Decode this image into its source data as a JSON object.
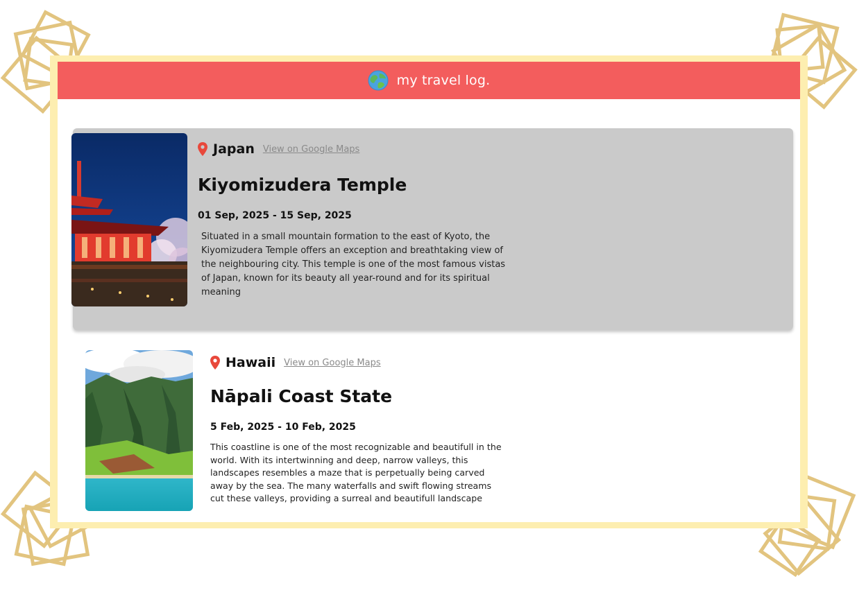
{
  "header": {
    "logo_icon": "globe-icon",
    "title": "my travel log."
  },
  "colors": {
    "header_bg": "#f35d5d",
    "frame": "#fdeeb0",
    "decoration": "#e2c47f",
    "selected_card": "#cacaca",
    "pin": "#e8483b"
  },
  "entries": [
    {
      "pin_icon": "location-pin-icon",
      "country": "Japan",
      "maps_link": "View on Google Maps",
      "place": "Kiyomizudera Temple",
      "dates": "01 Sep, 2025 - 15 Sep, 2025",
      "description": "Situated in a small mountain formation to the east of Kyoto, the Kiyomizudera Temple offers an exception and breathtaking view of the neighbouring city. This temple is one of the most famous vistas of Japan, known for its beauty all year-round and for its spiritual meaning",
      "photo_icon": "temple-photo"
    },
    {
      "pin_icon": "location-pin-icon",
      "country": "Hawaii",
      "maps_link": "View on Google Maps",
      "place": "Nāpali Coast State",
      "dates": "5 Feb, 2025 - 10 Feb, 2025",
      "description": "This coastline is one of the most recognizable and beautifull in the world. With its intertwinning and deep, narrow valleys, this landscapes resembles a maze that is perpetually being carved away by the sea. The many waterfalls and swift flowing streams cut these valleys, providing a surreal and beautifull landscape",
      "photo_icon": "coastline-photo"
    }
  ]
}
